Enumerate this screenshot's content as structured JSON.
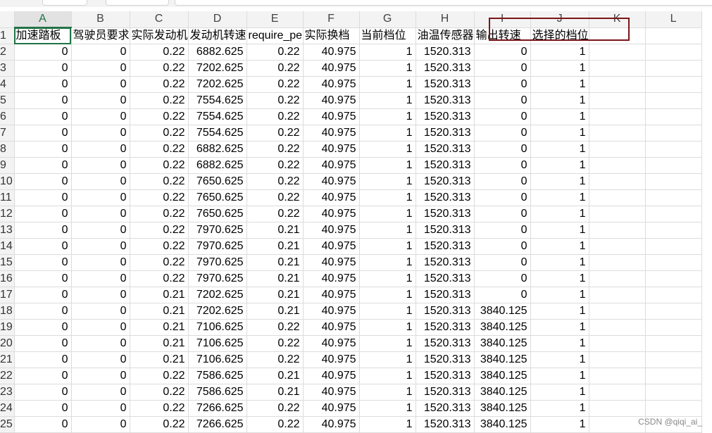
{
  "columns": [
    "A",
    "B",
    "C",
    "D",
    "E",
    "F",
    "G",
    "H",
    "I",
    "J",
    "K",
    "L"
  ],
  "active_column": "A",
  "header_row": [
    "加速踏板",
    "驾驶员要求",
    "实际发动机",
    "发动机转速",
    "require_pe",
    "实际换档",
    "当前档位",
    "油温传感器",
    "输出转速",
    "选择的档位",
    "",
    ""
  ],
  "rows": [
    [
      "0",
      "0",
      "0.22",
      "6882.625",
      "0.22",
      "40.975",
      "1",
      "1520.313",
      "0",
      "1"
    ],
    [
      "0",
      "0",
      "0.22",
      "7202.625",
      "0.22",
      "40.975",
      "1",
      "1520.313",
      "0",
      "1"
    ],
    [
      "0",
      "0",
      "0.22",
      "7202.625",
      "0.22",
      "40.975",
      "1",
      "1520.313",
      "0",
      "1"
    ],
    [
      "0",
      "0",
      "0.22",
      "7554.625",
      "0.22",
      "40.975",
      "1",
      "1520.313",
      "0",
      "1"
    ],
    [
      "0",
      "0",
      "0.22",
      "7554.625",
      "0.22",
      "40.975",
      "1",
      "1520.313",
      "0",
      "1"
    ],
    [
      "0",
      "0",
      "0.22",
      "7554.625",
      "0.22",
      "40.975",
      "1",
      "1520.313",
      "0",
      "1"
    ],
    [
      "0",
      "0",
      "0.22",
      "6882.625",
      "0.22",
      "40.975",
      "1",
      "1520.313",
      "0",
      "1"
    ],
    [
      "0",
      "0",
      "0.22",
      "6882.625",
      "0.22",
      "40.975",
      "1",
      "1520.313",
      "0",
      "1"
    ],
    [
      "0",
      "0",
      "0.22",
      "7650.625",
      "0.22",
      "40.975",
      "1",
      "1520.313",
      "0",
      "1"
    ],
    [
      "0",
      "0",
      "0.22",
      "7650.625",
      "0.22",
      "40.975",
      "1",
      "1520.313",
      "0",
      "1"
    ],
    [
      "0",
      "0",
      "0.22",
      "7650.625",
      "0.22",
      "40.975",
      "1",
      "1520.313",
      "0",
      "1"
    ],
    [
      "0",
      "0",
      "0.22",
      "7970.625",
      "0.21",
      "40.975",
      "1",
      "1520.313",
      "0",
      "1"
    ],
    [
      "0",
      "0",
      "0.22",
      "7970.625",
      "0.21",
      "40.975",
      "1",
      "1520.313",
      "0",
      "1"
    ],
    [
      "0",
      "0",
      "0.22",
      "7970.625",
      "0.21",
      "40.975",
      "1",
      "1520.313",
      "0",
      "1"
    ],
    [
      "0",
      "0",
      "0.22",
      "7970.625",
      "0.21",
      "40.975",
      "1",
      "1520.313",
      "0",
      "1"
    ],
    [
      "0",
      "0",
      "0.21",
      "7202.625",
      "0.21",
      "40.975",
      "1",
      "1520.313",
      "0",
      "1"
    ],
    [
      "0",
      "0",
      "0.21",
      "7202.625",
      "0.21",
      "40.975",
      "1",
      "1520.313",
      "3840.125",
      "1"
    ],
    [
      "0",
      "0",
      "0.21",
      "7106.625",
      "0.22",
      "40.975",
      "1",
      "1520.313",
      "3840.125",
      "1"
    ],
    [
      "0",
      "0",
      "0.21",
      "7106.625",
      "0.22",
      "40.975",
      "1",
      "1520.313",
      "3840.125",
      "1"
    ],
    [
      "0",
      "0",
      "0.21",
      "7106.625",
      "0.22",
      "40.975",
      "1",
      "1520.313",
      "3840.125",
      "1"
    ],
    [
      "0",
      "0",
      "0.22",
      "7586.625",
      "0.21",
      "40.975",
      "1",
      "1520.313",
      "3840.125",
      "1"
    ],
    [
      "0",
      "0",
      "0.22",
      "7586.625",
      "0.21",
      "40.975",
      "1",
      "1520.313",
      "3840.125",
      "1"
    ],
    [
      "0",
      "0",
      "0.22",
      "7266.625",
      "0.22",
      "40.975",
      "1",
      "1520.313",
      "3840.125",
      "1"
    ],
    [
      "0",
      "0",
      "0.22",
      "7266.625",
      "0.22",
      "40.975",
      "1",
      "1520.313",
      "3840.125",
      "1"
    ]
  ],
  "watermark": "CSDN @qiqi_ai_",
  "colors": {
    "highlight_box": "#7b1418",
    "selection": "#217346",
    "header_bg": "#f3f3f3"
  }
}
